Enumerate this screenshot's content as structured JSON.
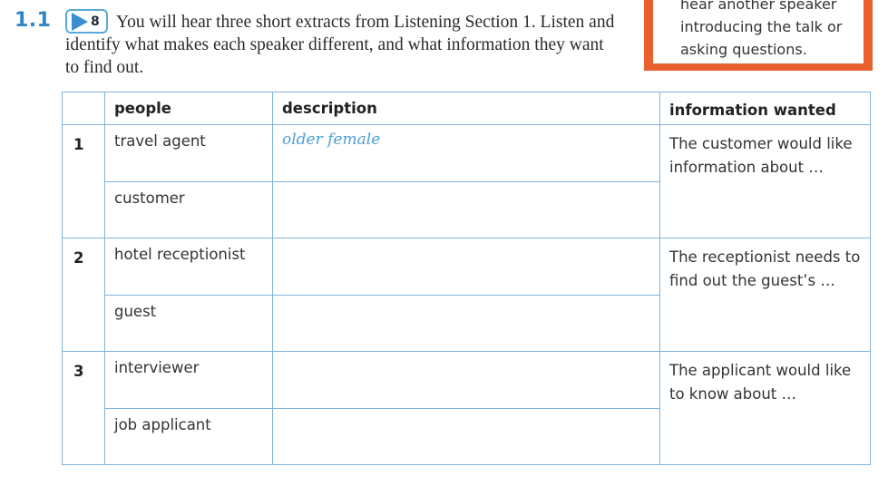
{
  "exercise": {
    "number": "1.1",
    "track": "8",
    "instruction": "You will hear three short extracts from Listening Section 1. Listen and identify what makes each speaker different, and what information they want to find out."
  },
  "tip": {
    "lines": [
      "hear another speaker",
      "introducing the talk or",
      "asking questions."
    ]
  },
  "table": {
    "headers": {
      "people": "people",
      "description": "description",
      "information": "information wanted"
    },
    "groups": [
      {
        "number": "1",
        "person_a": "travel agent",
        "person_a_description": "older female",
        "person_b": "customer",
        "person_b_description": "",
        "information": "The customer would like information about …"
      },
      {
        "number": "2",
        "person_a": "hotel receptionist",
        "person_a_description": "",
        "person_b": "guest",
        "person_b_description": "",
        "information": "The receptionist needs to find out the guest’s …"
      },
      {
        "number": "3",
        "person_a": "interviewer",
        "person_a_description": "",
        "person_b": "job applicant",
        "person_b_description": "",
        "information": "The applicant would like to know about …"
      }
    ]
  },
  "colors": {
    "accent_blue": "#2f86c6",
    "table_border": "#7fb3dd",
    "tip_orange": "#e8612e",
    "handwriting_blue": "#4d9ed6"
  }
}
